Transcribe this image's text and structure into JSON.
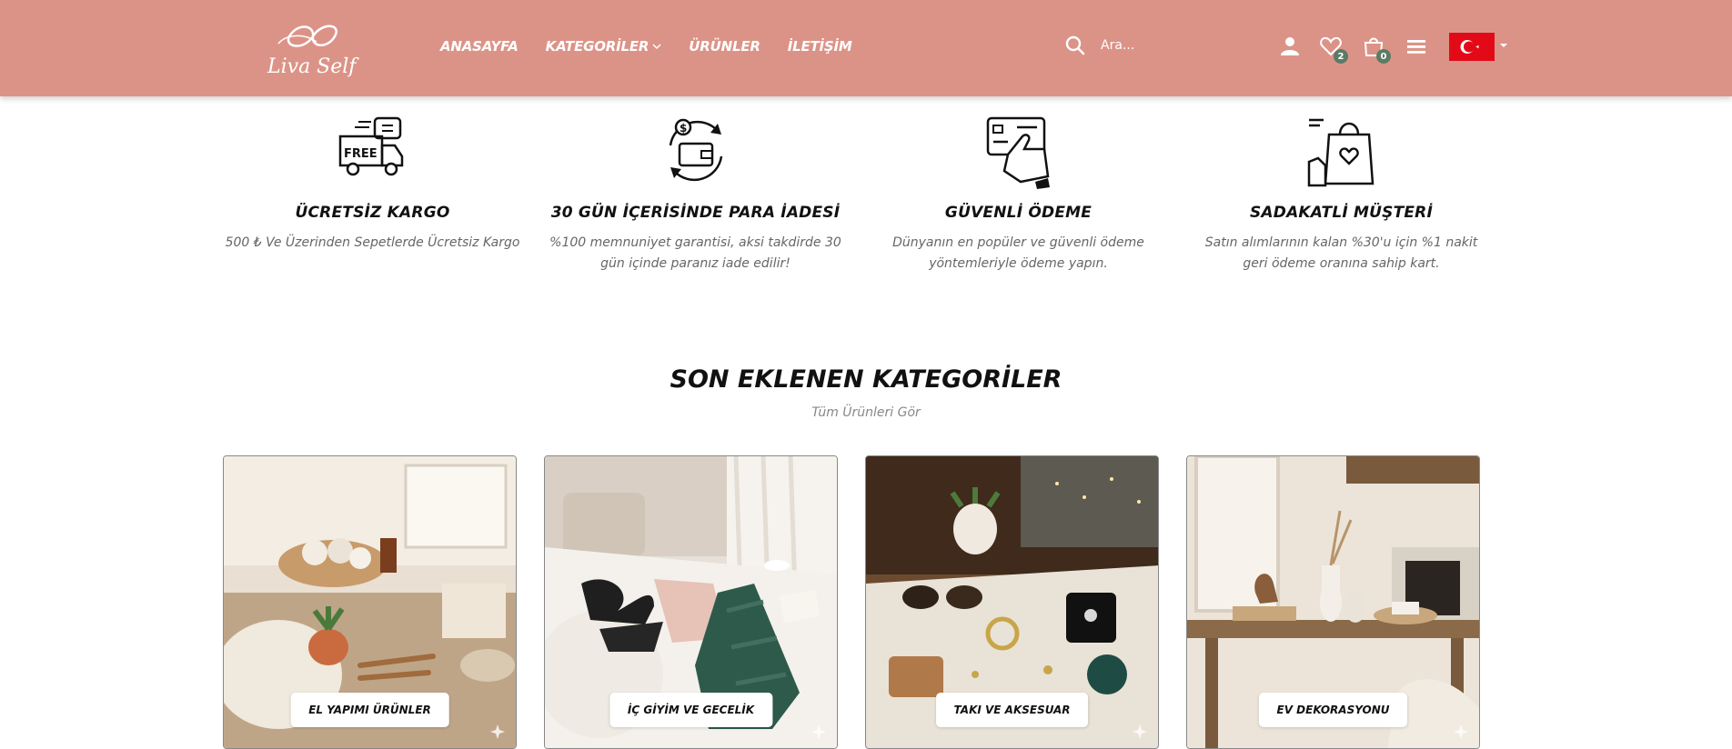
{
  "header": {
    "logo": {
      "text": "Liva Self",
      "icon": "infinity-logo"
    },
    "nav": [
      {
        "label": "ANASAYFA"
      },
      {
        "label": "KATEGORİLER",
        "icon": "chevron-down-icon"
      },
      {
        "label": "ÜRÜNLER"
      },
      {
        "label": "İLETİŞİM"
      }
    ],
    "search": {
      "placeholder": "Ara...",
      "value": "",
      "icon": "search-icon"
    },
    "icons": {
      "user": "user-icon",
      "wishlist": {
        "icon": "heart-icon",
        "count": "2"
      },
      "cart": {
        "icon": "shopping-bag-icon",
        "count": "0"
      },
      "menu": "hamburger-menu-icon"
    },
    "language": {
      "flag": "turkey-flag-icon",
      "caret": "caret-down-icon"
    }
  },
  "features": [
    {
      "icon": "free-shipping-truck-icon",
      "title": "ÜCRETSİZ KARGO",
      "text": "500 ₺ Ve Üzerinden Sepetlerde Ücretsiz Kargo"
    },
    {
      "icon": "money-back-icon",
      "title": "30 GÜN İÇERİSİNDE PARA İADESİ",
      "text": "%100 memnuniyet garantisi, aksi takdirde 30 gün içinde paranız iade edilir!"
    },
    {
      "icon": "card-payment-icon",
      "title": "GÜVENLİ ÖDEME",
      "text": "Dünyanın en popüler ve güvenli ödeme yöntemleriyle ödeme yapın."
    },
    {
      "icon": "loyal-customer-bag-icon",
      "title": "SADAKATLİ MÜŞTERİ",
      "text": "Satın alımlarının kalan %30'u için %1 nakit geri ödeme oranına sahip kart."
    }
  ],
  "categories": {
    "title": "SON EKLENEN KATEGORİLER",
    "link": "Tüm Ürünleri Gör",
    "items": [
      {
        "label": "EL YAPIMI ÜRÜNLER"
      },
      {
        "label": "İÇ GİYİM VE GECELİK"
      },
      {
        "label": "TAKI VE AKSESUAR"
      },
      {
        "label": "EV DEKORASYONU"
      }
    ]
  },
  "colors": {
    "header_bg": "#dc9387",
    "badge": "#5b7b65",
    "text_dark": "#111111",
    "text_muted": "#666666"
  }
}
